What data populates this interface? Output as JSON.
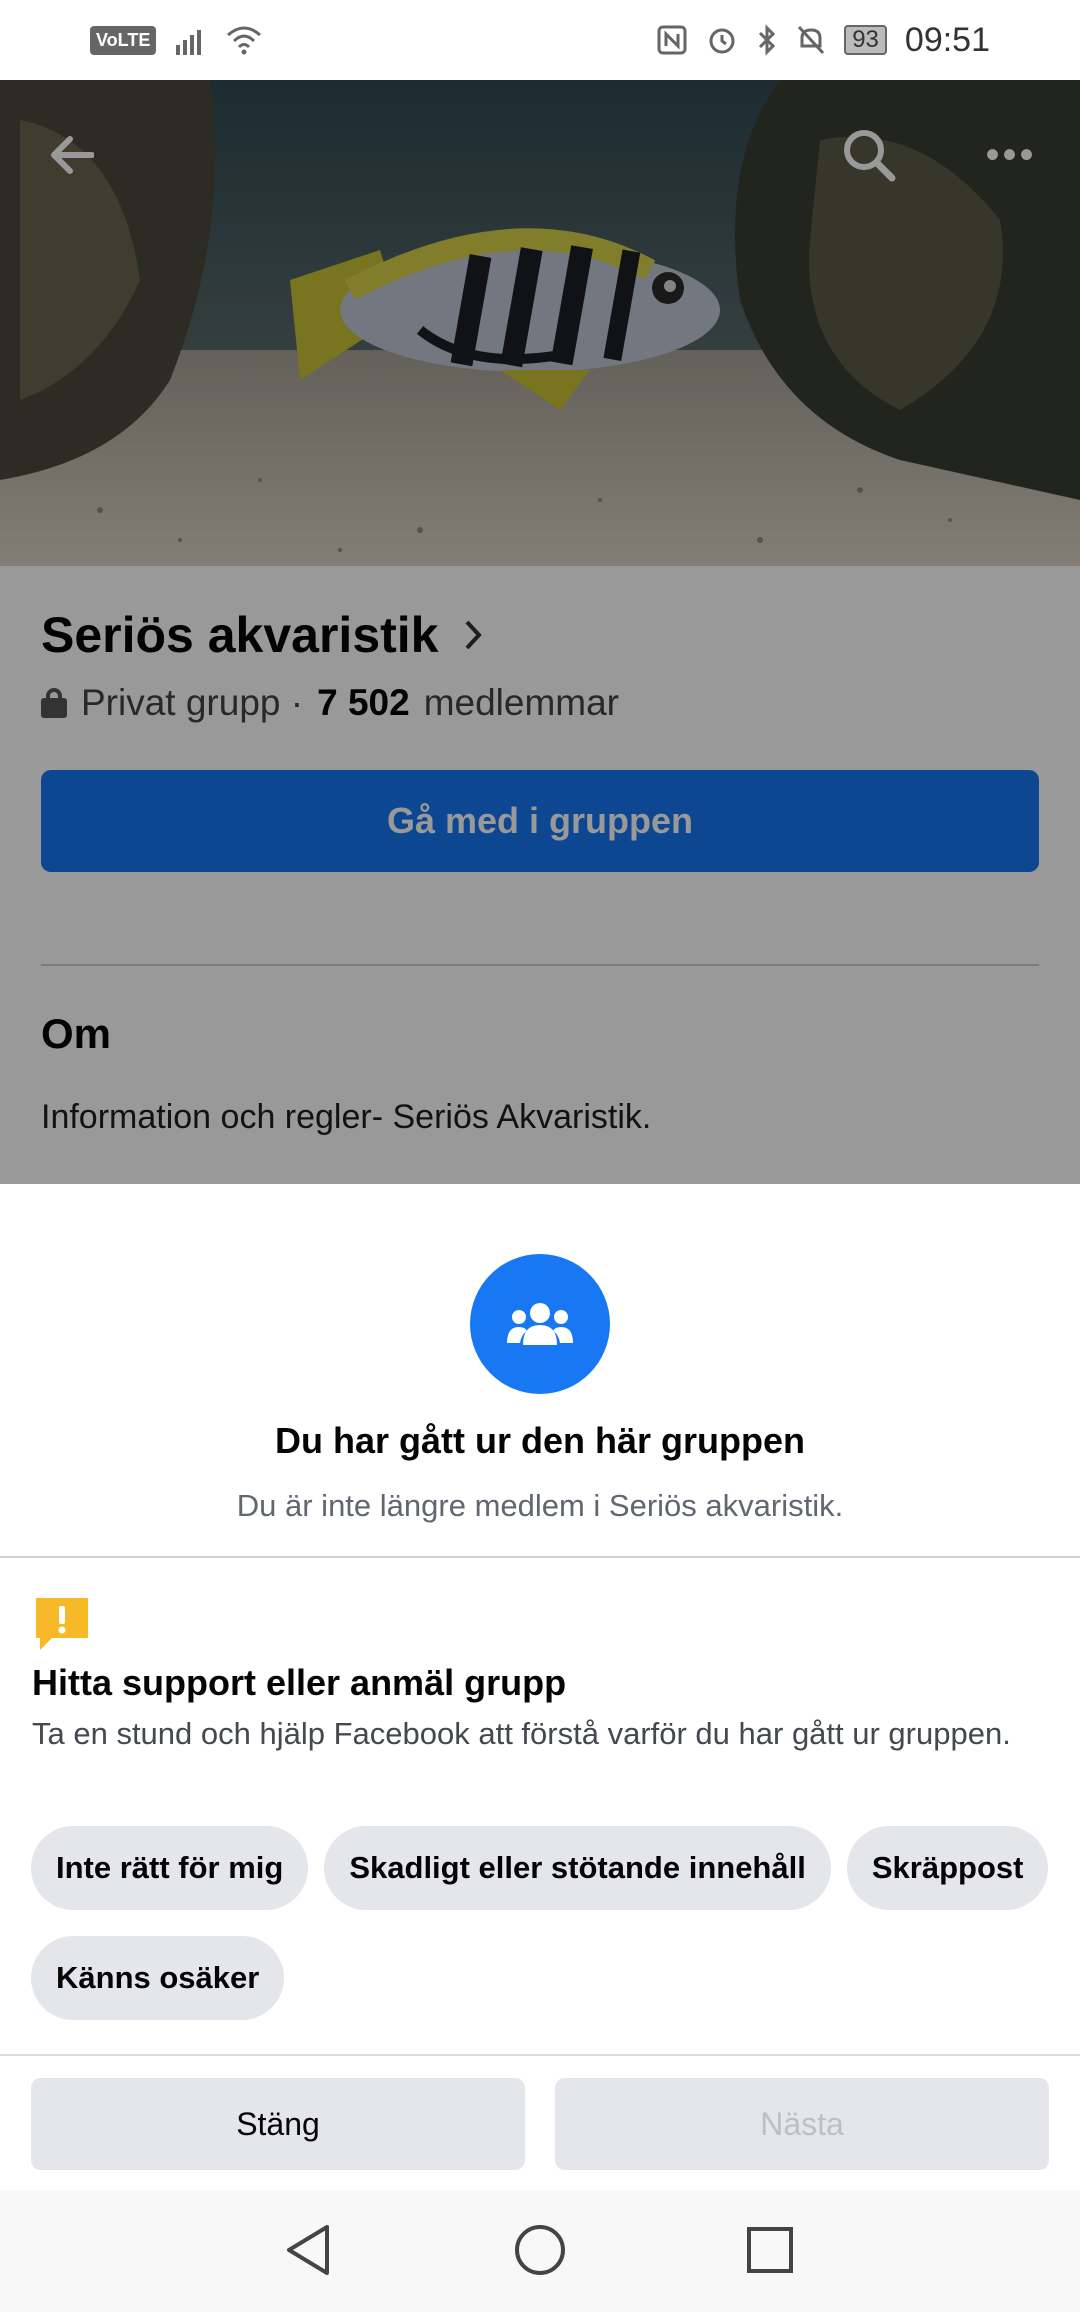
{
  "status_bar": {
    "network": "VoLTE",
    "battery": "93",
    "time": "09:51",
    "icons": [
      "volte-icon",
      "signal-icon",
      "wifi-icon",
      "nfc-icon",
      "alarm-icon",
      "bluetooth-icon",
      "mute-icon",
      "battery-icon"
    ]
  },
  "cover": {
    "icons": [
      "back-arrow-icon",
      "search-icon",
      "more-icon"
    ],
    "more_glyph": "•••"
  },
  "group": {
    "name": "Seriös akvaristik",
    "privacy": "Privat grupp ·",
    "members_count": "7 502",
    "members_label": "medlemmar",
    "join_button": "Gå med i gruppen",
    "about_title": "Om",
    "about_text": "Information och regler- Seriös Akvaristik."
  },
  "sheet": {
    "title": "Du har gått ur den här gruppen",
    "subtitle": "Du är inte längre medlem i Seriös akvaristik.",
    "report_title": "Hitta support eller anmäl grupp",
    "report_desc": "Ta en stund och hjälp Facebook att förstå varför du har gått ur gruppen.",
    "chips": [
      "Inte rätt för mig",
      "Skadligt eller stötande innehåll",
      "Skräppost",
      "Känns osäker"
    ],
    "close_button": "Stäng",
    "next_button": "Nästa",
    "colors": {
      "accent": "#1877f2",
      "warning": "#f7b928",
      "chip_bg": "#e4e6eb"
    }
  },
  "nav": {
    "icons": [
      "back-triangle-icon",
      "home-circle-icon",
      "recents-square-icon"
    ]
  }
}
